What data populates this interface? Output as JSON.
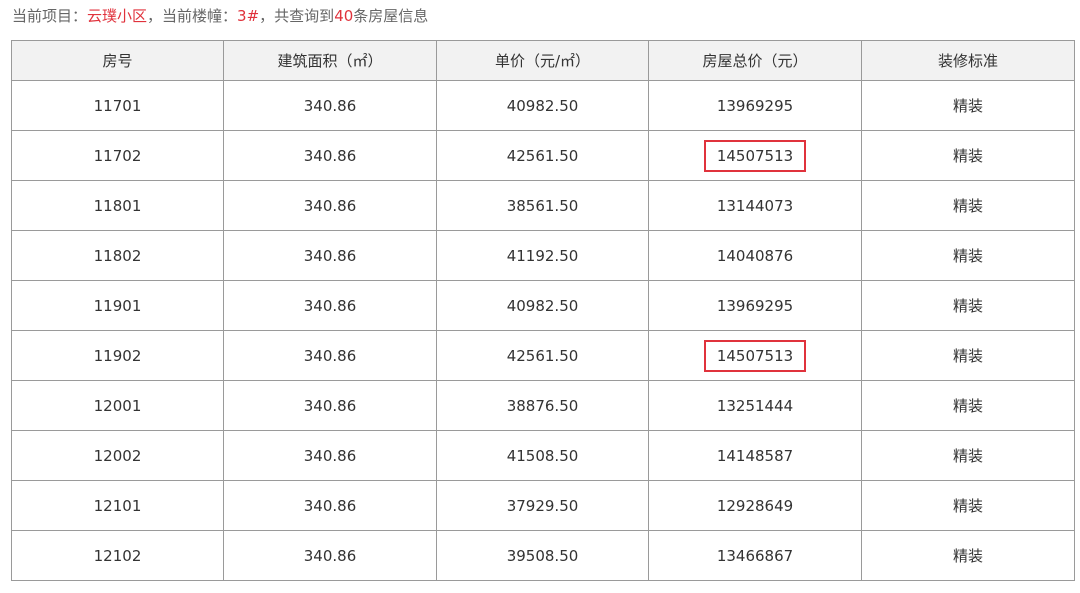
{
  "info": {
    "project_prefix": "当前项目：",
    "project_name": "云璞小区",
    "building_prefix": "，当前楼幢：",
    "building_name": "3#",
    "count_prefix": "，共查询到",
    "count": "40",
    "count_suffix": "条房屋信息",
    "highlight_color": "#e0323c"
  },
  "table": {
    "headers": [
      "房号",
      "建筑面积（㎡）",
      "单价（元/㎡）",
      "房屋总价（元）",
      "装修标准"
    ],
    "rows": [
      {
        "room": "11701",
        "area": "340.86",
        "unit_price": "40982.50",
        "total_price": "13969295",
        "decoration": "精装",
        "highlighted": false
      },
      {
        "room": "11702",
        "area": "340.86",
        "unit_price": "42561.50",
        "total_price": "14507513",
        "decoration": "精装",
        "highlighted": true
      },
      {
        "room": "11801",
        "area": "340.86",
        "unit_price": "38561.50",
        "total_price": "13144073",
        "decoration": "精装",
        "highlighted": false
      },
      {
        "room": "11802",
        "area": "340.86",
        "unit_price": "41192.50",
        "total_price": "14040876",
        "decoration": "精装",
        "highlighted": false
      },
      {
        "room": "11901",
        "area": "340.86",
        "unit_price": "40982.50",
        "total_price": "13969295",
        "decoration": "精装",
        "highlighted": false
      },
      {
        "room": "11902",
        "area": "340.86",
        "unit_price": "42561.50",
        "total_price": "14507513",
        "decoration": "精装",
        "highlighted": true
      },
      {
        "room": "12001",
        "area": "340.86",
        "unit_price": "38876.50",
        "total_price": "13251444",
        "decoration": "精装",
        "highlighted": false
      },
      {
        "room": "12002",
        "area": "340.86",
        "unit_price": "41508.50",
        "total_price": "14148587",
        "decoration": "精装",
        "highlighted": false
      },
      {
        "room": "12101",
        "area": "340.86",
        "unit_price": "37929.50",
        "total_price": "12928649",
        "decoration": "精装",
        "highlighted": false
      },
      {
        "room": "12102",
        "area": "340.86",
        "unit_price": "39508.50",
        "total_price": "13466867",
        "decoration": "精装",
        "highlighted": false
      }
    ]
  }
}
